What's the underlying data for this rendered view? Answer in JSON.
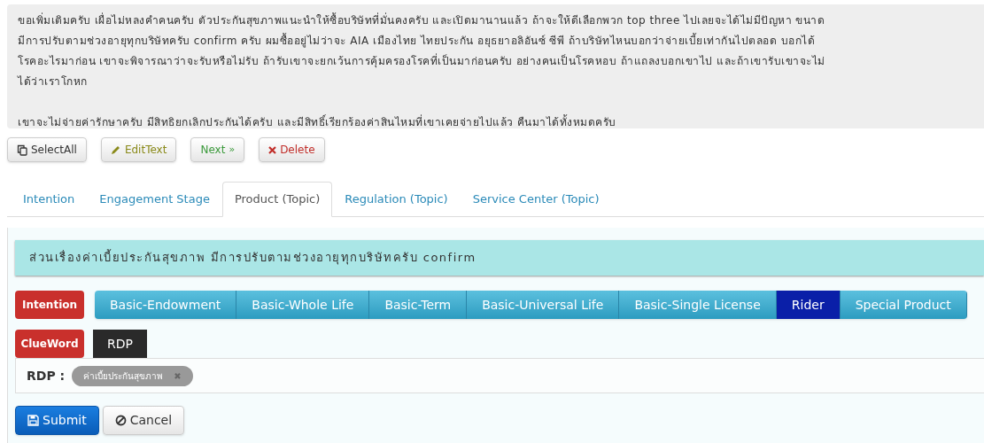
{
  "transcript": {
    "paragraphs": [
      [
        "ขอเพิ่มเติมครับ เผื่อไม่หลงคำคนครับ ตัวประกันสุขภาพแนะนำให้ซื้อบริษัทที่มั่นคงครับ และเปิดมานานแล้ว ถ้าจะให้ดีเลือกพวก top three ไปเลยจะได้ไม่มีปัญหา ขนาด",
        "มีการปรับตามช่วงอายุทุกบริษัทครับ confirm ครับ ผมซื้ออยู่ไม่ว่าจะ AIA เมืองไทย ไทยประกัน อยุธยาอลิอันซ์ ซีพี ถ้าบริษัทไหนบอกว่าจ่ายเบี้ยเท่ากันไปตลอด บอกได้",
        "โรคอะไรมาก่อน เขาจะพิจารณาว่าจะรับหรือไม่รับ ถ้ารับเขาจะยกเว้นการคุ้มครองโรคที่เป็นมาก่อนครับ อย่างคนเป็นโรคหอบ ถ้าแถลงบอกเขาไป และถ้าเขารับเขาจะไม่",
        "ได้ว่าเราโกหก"
      ],
      [
        "เขาจะไม่จ่ายค่ารักษาครับ มีสิทธิยกเลิกประกันได้ครับ และมีสิทธิ์เรียกร้องค่าสินไหมที่เขาเคยจ่ายไปแล้ว คืนมาได้ทั้งหมดครับ"
      ]
    ]
  },
  "toolbar": [
    {
      "kind": "select",
      "label": "SelectAll"
    },
    {
      "kind": "edit",
      "label": "EditText"
    },
    {
      "kind": "next",
      "label": "Next",
      "suffix": "»"
    },
    {
      "kind": "delete",
      "label": "Delete"
    }
  ],
  "tabs": [
    {
      "label": "Intention",
      "selected": false
    },
    {
      "label": "Engagement Stage",
      "selected": false
    },
    {
      "label": "Product (Topic)",
      "selected": true
    },
    {
      "label": "Regulation (Topic)",
      "selected": false
    },
    {
      "label": "Service Center (Topic)",
      "selected": false
    }
  ],
  "sentence": "ส่วนเรื่องค่าเบี้ยประกันสุขภาพ มีการปรับตามช่วงอายุทุกบริษัทครับ confirm",
  "intention": {
    "label": "Intention",
    "options": [
      {
        "label": "Basic-Endowment",
        "selected": false
      },
      {
        "label": "Basic-Whole Life",
        "selected": false
      },
      {
        "label": "Basic-Term",
        "selected": false
      },
      {
        "label": "Basic-Universal Life",
        "selected": false
      },
      {
        "label": "Basic-Single License",
        "selected": false
      },
      {
        "label": "Rider",
        "selected": true
      },
      {
        "label": "Special Product",
        "selected": false
      }
    ]
  },
  "clueword": {
    "label": "ClueWord",
    "tabs": [
      {
        "label": "RDP",
        "selected": true
      }
    ]
  },
  "assignment": {
    "key": "RDP :",
    "tags": [
      {
        "label": "ค่าเบี้ยประกันสุขภาพ",
        "remove": "✖"
      }
    ]
  },
  "actions": [
    {
      "kind": "submit",
      "label": "Submit"
    },
    {
      "kind": "cancel",
      "label": "Cancel"
    }
  ]
}
